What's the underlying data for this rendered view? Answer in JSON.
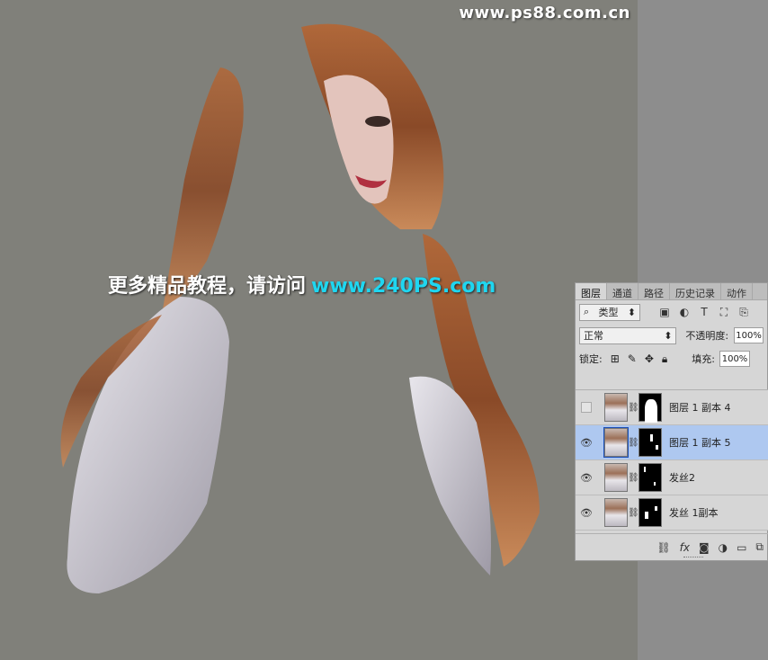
{
  "watermark_top": "www.ps88.com.cn",
  "promo": {
    "text": "更多精品教程，请访问",
    "url": "www.240PS.com"
  },
  "panel": {
    "tabs": [
      "图层",
      "通道",
      "路径",
      "历史记录",
      "动作"
    ],
    "filter": {
      "label": "类型",
      "icons": [
        "image-filter-icon",
        "adjustment-filter-icon",
        "type-filter-icon",
        "shape-filter-icon",
        "smart-object-filter-icon"
      ]
    },
    "blend_mode": "正常",
    "opacity_label": "不透明度:",
    "opacity_value": "100%",
    "lock_label": "锁定:",
    "fill_label": "填充:",
    "fill_value": "100%",
    "layers": [
      {
        "name": "图层 1 副本 4",
        "visible": false,
        "selected": false
      },
      {
        "name": "图层 1 副本 5",
        "visible": true,
        "selected": true
      },
      {
        "name": "发丝2",
        "visible": true,
        "selected": false
      },
      {
        "name": "发丝 1副本",
        "visible": true,
        "selected": false
      }
    ],
    "bottom_icons": [
      "link-icon",
      "fx-icon",
      "mask-icon",
      "adjustment-icon",
      "folder-icon",
      "new-layer-icon"
    ]
  }
}
